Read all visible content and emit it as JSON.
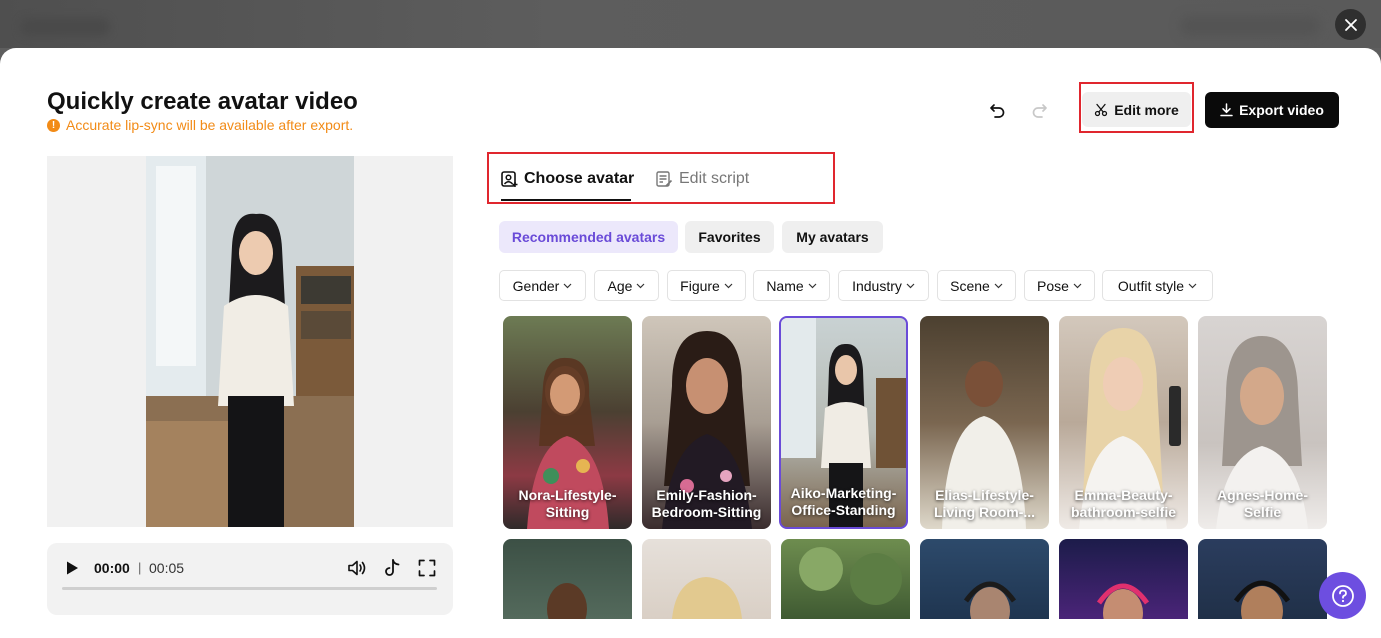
{
  "header": {
    "title": "Quickly create avatar video",
    "notice": "Accurate lip-sync will be available after export.",
    "edit_more_label": "Edit more",
    "export_label": "Export video"
  },
  "player": {
    "current_time": "00:00",
    "separator": "|",
    "total_time": "00:05",
    "progress": 0
  },
  "tabs": [
    {
      "label": "Choose avatar",
      "active": true
    },
    {
      "label": "Edit script",
      "active": false
    }
  ],
  "categories": [
    {
      "label": "Recommended avatars",
      "active": true
    },
    {
      "label": "Favorites",
      "active": false
    },
    {
      "label": "My avatars",
      "active": false
    }
  ],
  "filters": [
    "Gender",
    "Age",
    "Figure",
    "Name",
    "Industry",
    "Scene",
    "Pose",
    "Outfit style"
  ],
  "avatars": [
    {
      "name": "Nora-Lifestyle-Sitting",
      "selected": false
    },
    {
      "name": "Emily-Fashion-Bedroom-Sitting",
      "selected": false
    },
    {
      "name": "Aiko-Marketing-Office-Standing",
      "selected": true
    },
    {
      "name": "Elias-Lifestyle-Living Room-...",
      "selected": false
    },
    {
      "name": "Emma-Beauty-bathroom-selfie",
      "selected": false
    },
    {
      "name": "Agnes-Home-Selfie",
      "selected": false
    }
  ],
  "colors": {
    "accent": "#6a4bd8",
    "warning": "#f28b17",
    "highlight_box": "#e0262e"
  },
  "icons": {
    "close": "close-icon",
    "undo": "undo-icon",
    "redo": "redo-icon",
    "scissors": "scissors-icon",
    "download": "download-icon",
    "help": "help-icon"
  }
}
